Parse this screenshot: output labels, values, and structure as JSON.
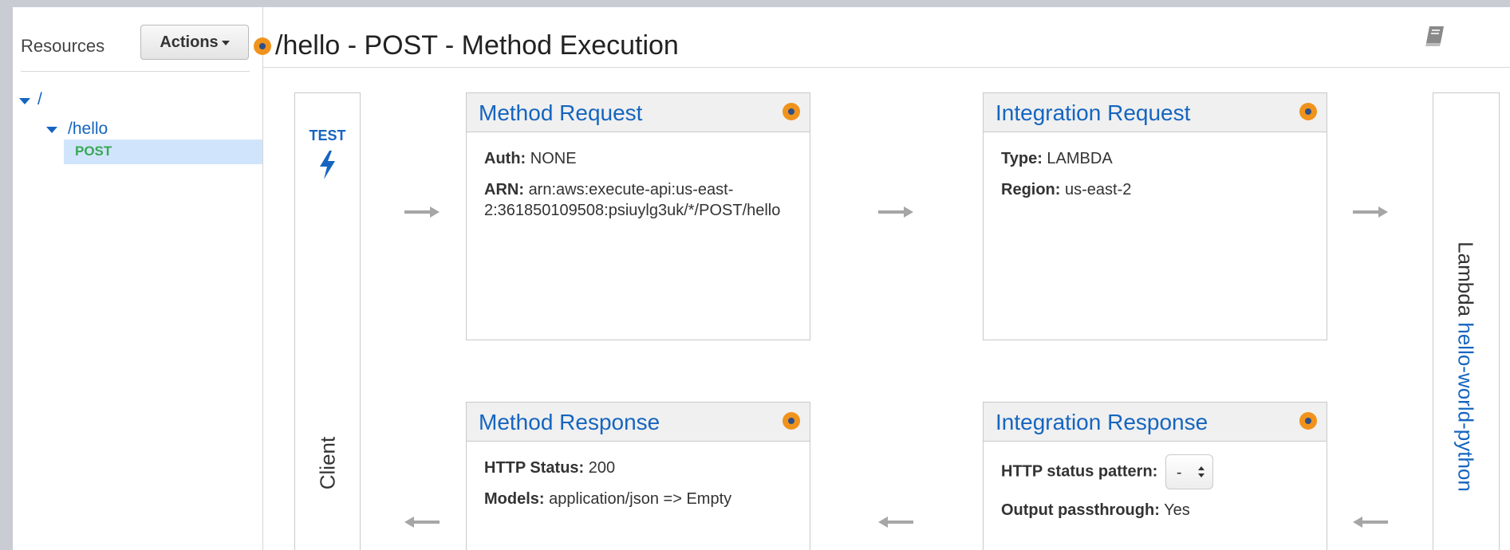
{
  "sidebar": {
    "title": "Resources",
    "actions_label": "Actions",
    "tree": {
      "root": "/",
      "child": "/hello",
      "method": "POST"
    }
  },
  "header": {
    "title": "/hello - POST - Method Execution"
  },
  "client": {
    "test_label": "TEST",
    "label": "Client"
  },
  "lambda": {
    "prefix": "Lambda",
    "function_name": "hello-world-python"
  },
  "method_request": {
    "title": "Method Request",
    "auth_key": "Auth:",
    "auth_value": "NONE",
    "arn_key": "ARN:",
    "arn_value_line1": "arn:aws:execute-api:us-east-",
    "arn_value_line2": "2:361850109508:psiuylg3uk/*/POST/hello"
  },
  "integration_request": {
    "title": "Integration Request",
    "type_key": "Type:",
    "type_value": "LAMBDA",
    "region_key": "Region:",
    "region_value": "us-east-2"
  },
  "method_response": {
    "title": "Method Response",
    "status_key": "HTTP Status:",
    "status_value": "200",
    "models_key": "Models:",
    "models_value": "application/json => Empty"
  },
  "integration_response": {
    "title": "Integration Response",
    "pattern_key": "HTTP status pattern:",
    "pattern_value": "-",
    "passthrough_key": "Output passthrough:",
    "passthrough_value": "Yes"
  },
  "colors": {
    "link_blue": "#1565c0",
    "method_green": "#3aa757",
    "status_orange": "#f0931c",
    "selected_row": "#d0e5fb",
    "arrow_gray": "#a6a6a6"
  },
  "icons": [
    "caret-down-icon",
    "orange-status-icon",
    "book-icon",
    "lightning-bolt-icon",
    "right-arrow-icon",
    "left-arrow-icon",
    "up-down-chevron-icon"
  ]
}
